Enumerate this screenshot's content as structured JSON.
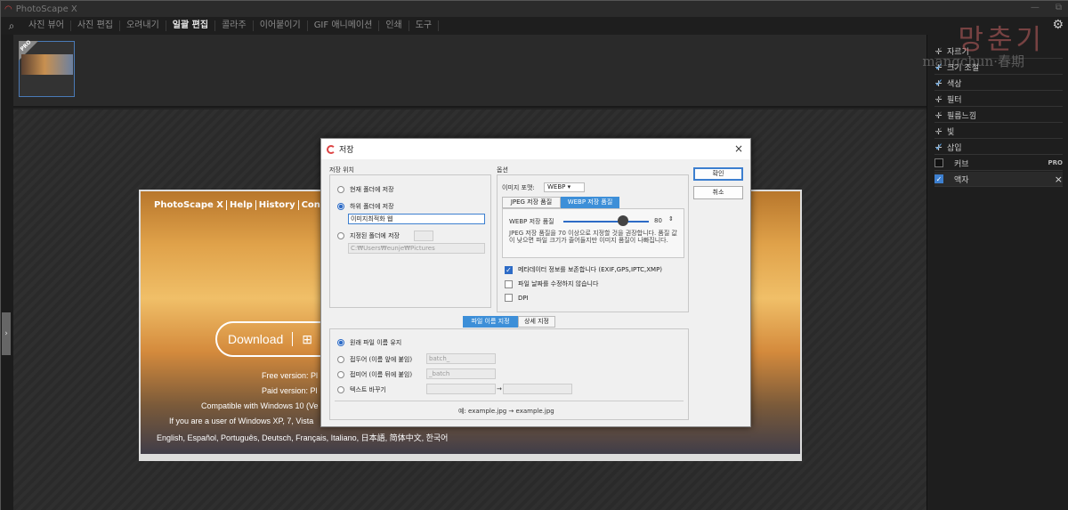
{
  "window": {
    "title": "PhotoScape X",
    "controls": [
      "—",
      "⧉"
    ]
  },
  "menu": {
    "items": [
      "사진 뷰어",
      "사진 편집",
      "오려내기",
      "일괄 편집",
      "콜라주",
      "이어붙이기",
      "GIF 애니메이션",
      "인쇄",
      "도구"
    ],
    "active_index": 3
  },
  "watermark": {
    "main": "망춘기",
    "sub": "mangchun·春期"
  },
  "thumbnail": {
    "badge": "PRO"
  },
  "photo": {
    "nav": [
      "PhotoScape X",
      "Help",
      "History",
      "Contact"
    ],
    "download": "Download",
    "lines": [
      "Free version: Pl",
      "Paid version: Pl",
      "Compatible with Windows 10 (Ve",
      "If you are a user of Windows XP, 7, Vista",
      "English, Español, Português, Deutsch, Français, Italiano, 日本語, 简体中文, 한국어"
    ]
  },
  "right_panel": {
    "items": [
      {
        "label": "자르기",
        "state": "dim"
      },
      {
        "label": "크기 조절",
        "state": "on"
      },
      {
        "label": "색상",
        "state": "on"
      },
      {
        "label": "필터",
        "state": "dim"
      },
      {
        "label": "필름느낌",
        "state": "dim"
      },
      {
        "label": "빛",
        "state": "dim"
      },
      {
        "label": "삽입",
        "state": "on"
      }
    ],
    "curve": {
      "label": "커브",
      "badge": "PRO"
    },
    "frame": {
      "label": "액자",
      "close": "×"
    }
  },
  "dialog": {
    "title": "저장",
    "close": "×",
    "location": {
      "label": "저장 위치",
      "current_folder": "현재 폴더에 저장",
      "sub_folder": "하위 폴더에 저장",
      "sub_folder_value": "이미지최적화 웹",
      "specified_folder": "지정된 폴더에 저장",
      "specified_path": "C:₩Users₩eunje₩Pictures"
    },
    "options": {
      "label": "옵션",
      "format_label": "이미지 포맷:",
      "format_value": "WEBP",
      "tabs": [
        "JPEG 저장 품질",
        "WEBP 저장 품질"
      ],
      "quality_label": "WEBP 저장 품질",
      "quality_value": "80",
      "quality_fraction": 0.8,
      "quality_note": "JPEG 저장 품질을 70 이상으로 지정할 것을 권장합니다. 품질 값이 낮으면 파일 크기가 줄어들지만 이미지 품질이 나빠집니다.",
      "keep_meta": "메타데이터 정보를 보존합니다 (EXIF,GPS,IPTC,XMP)",
      "keep_date": "파일 날짜를 수정하지 않습니다",
      "dpi": "DPI"
    },
    "buttons": {
      "ok": "확인",
      "cancel": "취소"
    },
    "naming": {
      "tabs": [
        "파일 이름 지정",
        "상세 지정"
      ],
      "keep": "원래 파일 이름 유지",
      "prefix": "접두어 (이름 앞에 붙임)",
      "prefix_placeholder": "batch_",
      "suffix": "접미어 (이름 뒤에 붙임)",
      "suffix_placeholder": "_batch",
      "replace": "텍스트 바꾸기",
      "arrow": "→",
      "example": "예: example.jpg → example.jpg"
    }
  }
}
